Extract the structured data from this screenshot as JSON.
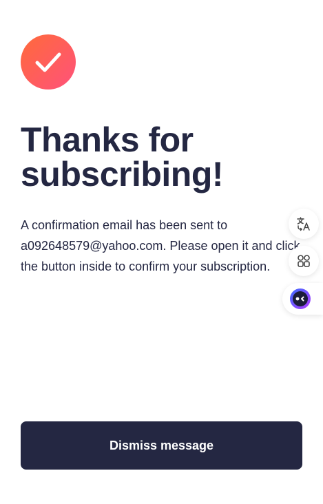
{
  "success_icon": "check-icon",
  "title": "Thanks for subscribing!",
  "message": "A confirmation email has been sent to a092648579@yahoo.com. Please open it and click the button inside to confirm your subscription.",
  "dismiss_button": {
    "label": "Dismiss message"
  },
  "floating_toolbar": {
    "translate_icon": "translate-icon",
    "apps_icon": "apps-grid-icon",
    "assistant_icon": "assistant-face-icon"
  },
  "colors": {
    "dark_navy": "#242742",
    "accent_start": "#ff6a3a",
    "accent_end": "#ff527b",
    "background": "#ffffff"
  }
}
